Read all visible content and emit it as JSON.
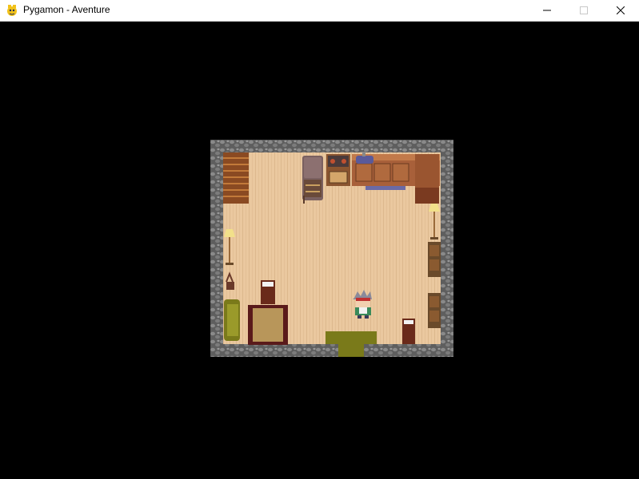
{
  "window": {
    "title": "Pygamon - Aventure",
    "minimize_label": "─",
    "maximize_label": "☐",
    "close_label": "✕"
  },
  "scene": {
    "type": "top-down house interior",
    "objects": [
      "stairs",
      "refrigerator",
      "stove",
      "kitchen-counter",
      "sink",
      "floor-lamp-left",
      "floor-lamp-right",
      "potted-plant",
      "sofa",
      "dining-table",
      "chair-top",
      "chair-bottom",
      "bookshelf-upper",
      "bookshelf-lower",
      "door-mat",
      "player-character"
    ],
    "colors": {
      "wall_stone": "#6b6b6b",
      "floor_wood": "#e8c49a",
      "door_mat": "#7a7a1a"
    }
  }
}
